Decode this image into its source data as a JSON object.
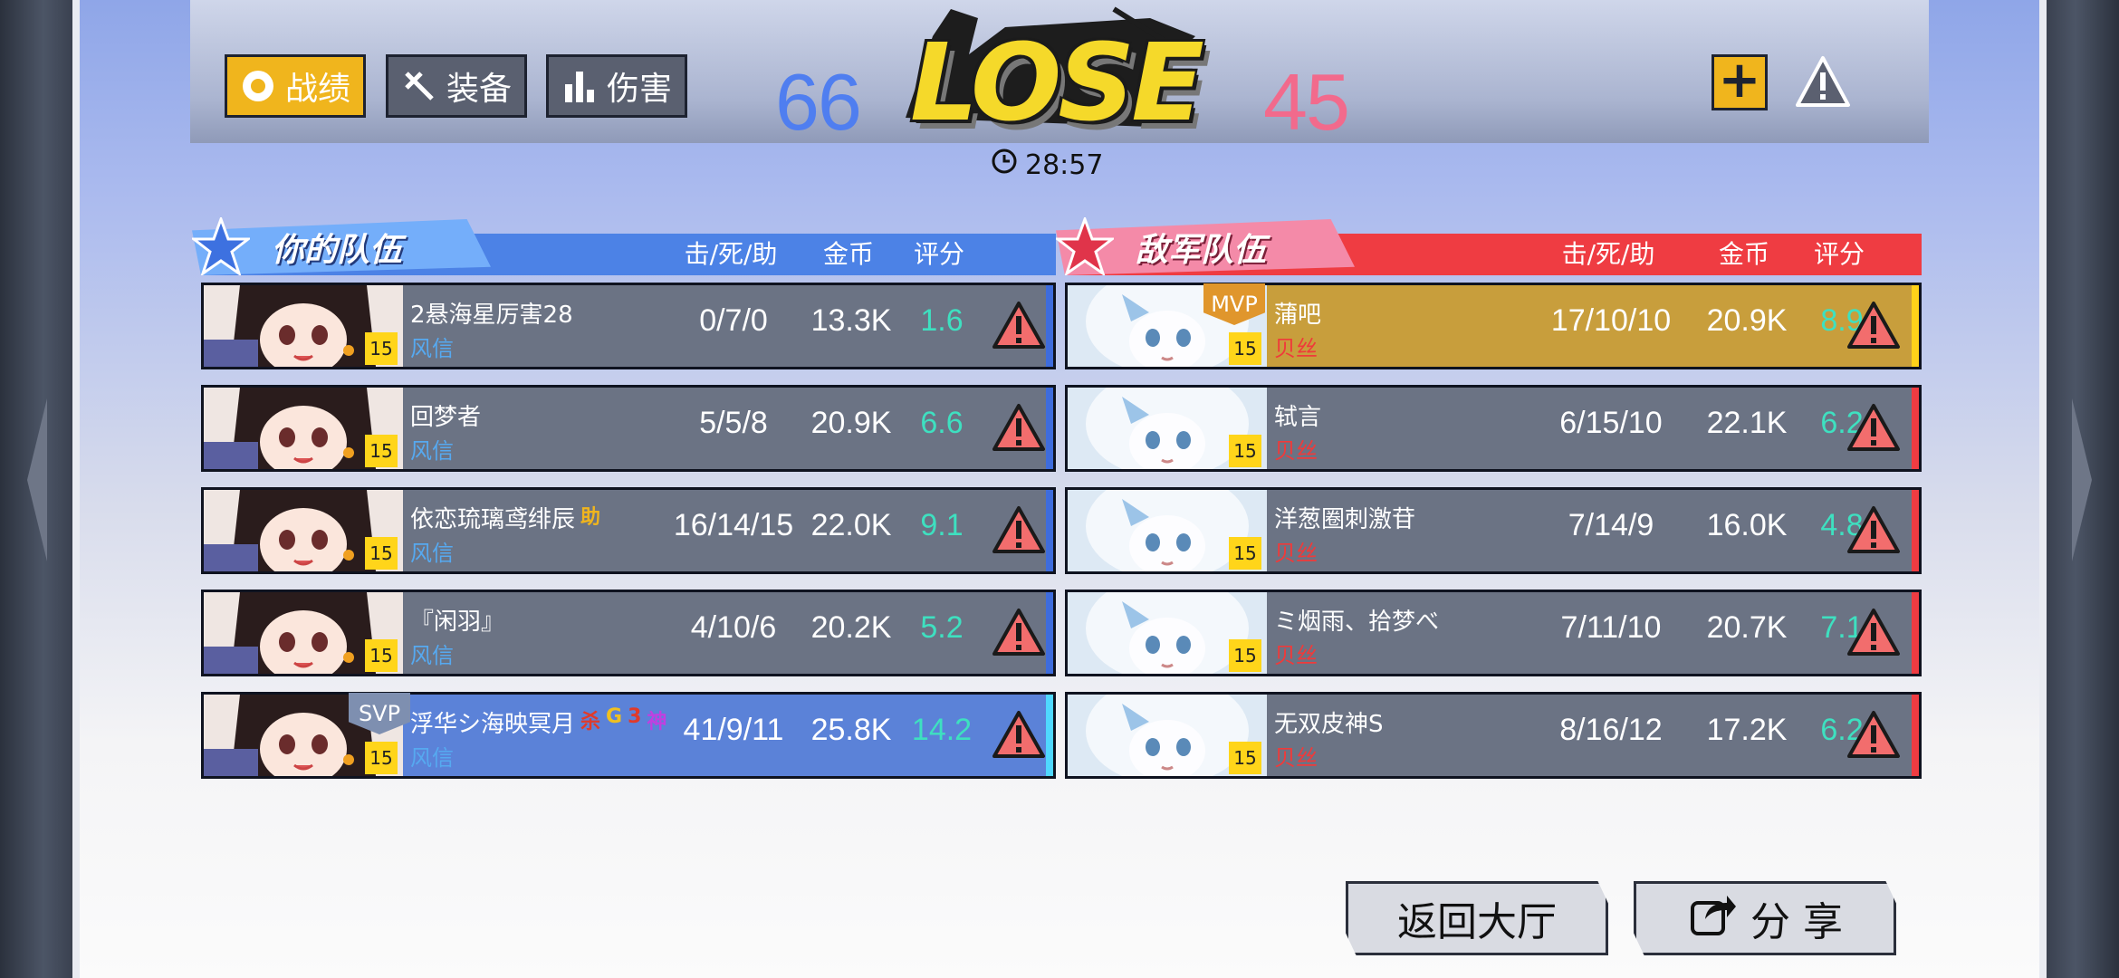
{
  "tabs": [
    {
      "label": "战绩",
      "icon": "ring-icon",
      "active": true
    },
    {
      "label": "装备",
      "icon": "equipment-icon",
      "active": false
    },
    {
      "label": "伤害",
      "icon": "bar-chart-icon",
      "active": false
    }
  ],
  "result": {
    "text": "LOSE",
    "blue_score": "66",
    "red_score": "45"
  },
  "timer": "28:57",
  "ally_team": {
    "title": "你的队伍",
    "columns": {
      "kda": "击/死/助",
      "gold": "金币",
      "rating": "评分"
    },
    "players": [
      {
        "name": "2悬海星厉害28",
        "hero": "风信",
        "level": "15",
        "kda": "0/7/0",
        "gold": "13.3K",
        "rating": "1.6"
      },
      {
        "name": "回梦者",
        "hero": "风信",
        "level": "15",
        "kda": "5/5/8",
        "gold": "20.9K",
        "rating": "6.6"
      },
      {
        "name": "依恋琉璃鸢绯辰",
        "tags": [
          "助"
        ],
        "hero": "风信",
        "level": "15",
        "kda": "16/14/15",
        "gold": "22.0K",
        "rating": "9.1"
      },
      {
        "name": "『闲羽』",
        "hero": "风信",
        "level": "15",
        "kda": "4/10/6",
        "gold": "20.2K",
        "rating": "5.2"
      },
      {
        "name": "浮华シ海映冥月",
        "tags": [
          "杀",
          "G",
          "3",
          "神"
        ],
        "badge": "SVP",
        "hero": "风信",
        "level": "15",
        "kda": "41/9/11",
        "gold": "25.8K",
        "rating": "14.2"
      }
    ]
  },
  "enemy_team": {
    "title": "敌军队伍",
    "columns": {
      "kda": "击/死/助",
      "gold": "金币",
      "rating": "评分"
    },
    "players": [
      {
        "name": "蒲吧",
        "badge": "MVP",
        "hero": "贝丝",
        "level": "15",
        "kda": "17/10/10",
        "gold": "20.9K",
        "rating": "8.9"
      },
      {
        "name": "轼言",
        "hero": "贝丝",
        "level": "15",
        "kda": "6/15/10",
        "gold": "22.1K",
        "rating": "6.2"
      },
      {
        "name": "洋葱圈刺激苷",
        "hero": "贝丝",
        "level": "15",
        "kda": "7/14/9",
        "gold": "16.0K",
        "rating": "4.8"
      },
      {
        "name": "ミ烟雨、拾梦べ",
        "hero": "贝丝",
        "level": "15",
        "kda": "7/11/10",
        "gold": "20.7K",
        "rating": "7.1"
      },
      {
        "name": "无双皮神S",
        "hero": "贝丝",
        "level": "15",
        "kda": "8/16/12",
        "gold": "17.2K",
        "rating": "6.2"
      }
    ]
  },
  "buttons": {
    "lobby": "返回大厅",
    "share": "分 享"
  },
  "colors": {
    "ally_accent": "#4c82e6",
    "enemy_accent": "#ef3c42",
    "active_tab": "#f0b51d",
    "rating_text": "#3ee0c0"
  }
}
